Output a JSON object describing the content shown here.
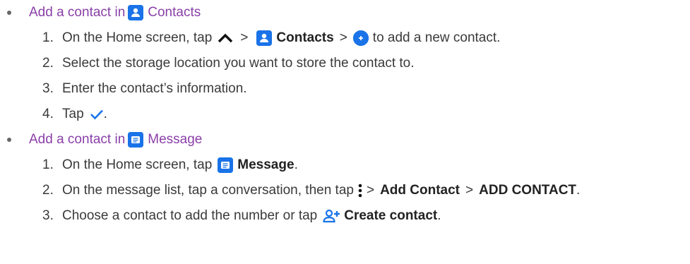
{
  "colors": {
    "accent": "#1a73e8",
    "heading": "#8a3fa8",
    "text": "#3a3a3a"
  },
  "sections": [
    {
      "heading_pre": "Add a contact in",
      "heading_app": "Contacts",
      "steps": [
        {
          "num": "1.",
          "parts": [
            "On the Home screen, tap",
            ">",
            "Contacts",
            ">",
            "to add a new contact."
          ]
        },
        {
          "num": "2.",
          "text": "Select the storage location you want to store the contact to."
        },
        {
          "num": "3.",
          "text": "Enter the contact’s information."
        },
        {
          "num": "4.",
          "text": "Tap",
          "end": "."
        }
      ]
    },
    {
      "heading_pre": "Add a contact in",
      "heading_app": "Message",
      "steps": [
        {
          "num": "1.",
          "parts": [
            "On the Home screen, tap",
            "Message",
            "."
          ]
        },
        {
          "num": "2.",
          "parts": [
            "On the message list, tap a conversation, then tap",
            ">",
            "Add Contact",
            ">",
            "ADD CONTACT",
            "."
          ]
        },
        {
          "num": "3.",
          "parts": [
            "Choose a contact to add the number or tap",
            "Create contact",
            "."
          ]
        }
      ]
    }
  ],
  "icons": [
    "contacts-app-icon",
    "chevron-up-icon",
    "add-circle-icon",
    "checkmark-icon",
    "message-app-icon",
    "more-vert-icon",
    "person-add-icon"
  ]
}
